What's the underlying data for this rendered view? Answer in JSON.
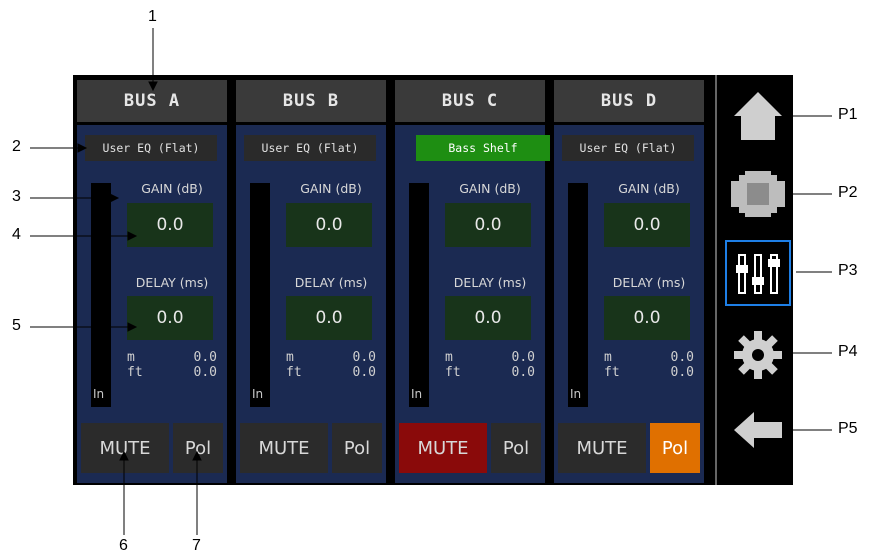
{
  "buses": [
    {
      "name": "BUS A",
      "eq": "User EQ (Flat)",
      "eq_active": false,
      "gain_label": "GAIN (dB)",
      "gain": "0.0",
      "delay_label": "DELAY (ms)",
      "delay": "0.0",
      "m_unit": "m",
      "m_value": "0.0",
      "ft_unit": "ft",
      "ft_value": "0.0",
      "in_label": "In",
      "mute_label": "MUTE",
      "mute_on": false,
      "pol_label": "Pol",
      "pol_on": false
    },
    {
      "name": "BUS B",
      "eq": "User EQ (Flat)",
      "eq_active": false,
      "gain_label": "GAIN (dB)",
      "gain": "0.0",
      "delay_label": "DELAY (ms)",
      "delay": "0.0",
      "m_unit": "m",
      "m_value": "0.0",
      "ft_unit": "ft",
      "ft_value": "0.0",
      "in_label": "In",
      "mute_label": "MUTE",
      "mute_on": false,
      "pol_label": "Pol",
      "pol_on": false
    },
    {
      "name": "BUS C",
      "eq": "Bass Shelf",
      "eq_active": true,
      "gain_label": "GAIN (dB)",
      "gain": "0.0",
      "delay_label": "DELAY (ms)",
      "delay": "0.0",
      "m_unit": "m",
      "m_value": "0.0",
      "ft_unit": "ft",
      "ft_value": "0.0",
      "in_label": "In",
      "mute_label": "MUTE",
      "mute_on": true,
      "pol_label": "Pol",
      "pol_on": false
    },
    {
      "name": "BUS D",
      "eq": "User EQ (Flat)",
      "eq_active": false,
      "gain_label": "GAIN (dB)",
      "gain": "0.0",
      "delay_label": "DELAY (ms)",
      "delay": "0.0",
      "m_unit": "m",
      "m_value": "0.0",
      "ft_unit": "ft",
      "ft_value": "0.0",
      "in_label": "In",
      "mute_label": "MUTE",
      "mute_on": false,
      "pol_label": "Pol",
      "pol_on": true
    }
  ],
  "nav": [
    {
      "icon": "home-icon",
      "callout": "P1"
    },
    {
      "icon": "device-icon",
      "callout": "P2"
    },
    {
      "icon": "mixer-sliders-icon",
      "callout": "P3",
      "selected": true
    },
    {
      "icon": "gear-icon",
      "callout": "P4"
    },
    {
      "icon": "back-arrow-icon",
      "callout": "P5"
    }
  ],
  "callouts": {
    "c1": "1",
    "c2": "2",
    "c3": "3",
    "c4": "4",
    "c5": "5",
    "c6": "6",
    "c7": "7",
    "p1": "P1",
    "p2": "P2",
    "p3": "P3",
    "p4": "P4",
    "p5": "P5"
  },
  "colors": {
    "panel": "#1b2a52",
    "eq_active": "#1e8e12",
    "mute_on": "#8a0a0a",
    "pol_on": "#e07000",
    "selected_outline": "#1e7fe6"
  }
}
